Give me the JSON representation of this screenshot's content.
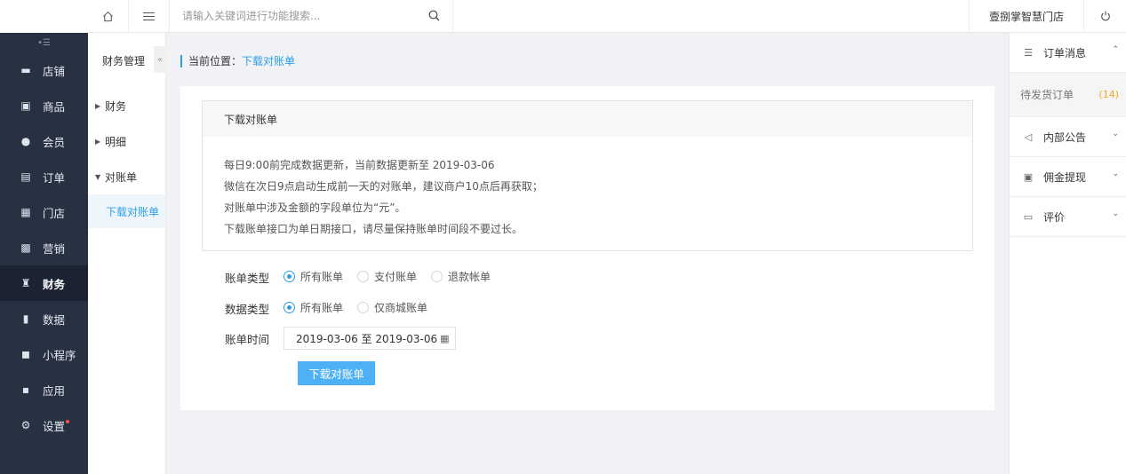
{
  "sidebar": {
    "items": [
      {
        "label": "店铺",
        "icon": "store-icon",
        "glyph": "▬"
      },
      {
        "label": "商品",
        "icon": "product-icon",
        "glyph": "▣"
      },
      {
        "label": "会员",
        "icon": "member-icon",
        "glyph": "●"
      },
      {
        "label": "订单",
        "icon": "order-icon",
        "glyph": "▤"
      },
      {
        "label": "门店",
        "icon": "shop-icon",
        "glyph": "▦"
      },
      {
        "label": "营销",
        "icon": "marketing-icon",
        "glyph": "▩"
      },
      {
        "label": "财务",
        "icon": "finance-icon",
        "glyph": "♜"
      },
      {
        "label": "数据",
        "icon": "data-icon",
        "glyph": "▮"
      },
      {
        "label": "小程序",
        "icon": "miniprogram-icon",
        "glyph": "◼"
      },
      {
        "label": "应用",
        "icon": "apps-icon",
        "glyph": "▪"
      },
      {
        "label": "设置",
        "icon": "settings-icon",
        "glyph": "⚙"
      }
    ],
    "active_index": 6
  },
  "topbar": {
    "search_placeholder": "请输入关键词进行功能搜索...",
    "store_name": "壹捌掌智慧门店"
  },
  "submenu": {
    "title": "财务管理",
    "items": [
      {
        "label": "财务",
        "arrow": "▶"
      },
      {
        "label": "明细",
        "arrow": "▶"
      },
      {
        "label": "对账单",
        "arrow": "▼"
      }
    ],
    "active_sub": "下载对账单"
  },
  "breadcrumb": {
    "prefix": "当前位置：",
    "current": "下载对账单"
  },
  "info": {
    "title": "下载对账单",
    "lines": [
      "每日9:00前完成数据更新，当前数据更新至 2019-03-06",
      "微信在次日9点启动生成前一天的对账单，建议商户10点后再获取；",
      "对账单中涉及金额的字段单位为“元”。",
      "下载账单接口为单日期接口，请尽量保持账单时间段不要过长。"
    ]
  },
  "form": {
    "bill_type_label": "账单类型",
    "bill_type_options": [
      "所有账单",
      "支付账单",
      "退款帐单"
    ],
    "bill_type_selected": 0,
    "data_type_label": "数据类型",
    "data_type_options": [
      "所有账单",
      "仅商城账单"
    ],
    "data_type_selected": 0,
    "bill_time_label": "账单时间",
    "bill_time_value": "2019-03-06 至 2019-03-06",
    "download_button": "下载对账单"
  },
  "right_panel": {
    "order_msg": "订单消息",
    "pending_ship": "待发货订单",
    "pending_count": "(14)",
    "notice": "内部公告",
    "commission": "佣金提现",
    "review": "评价"
  },
  "colors": {
    "sidebar_bg": "#273142",
    "accent": "#2c9ee8",
    "button": "#4fb1f5",
    "badge_dot": "#ff4d4f",
    "count": "#f5a623"
  }
}
